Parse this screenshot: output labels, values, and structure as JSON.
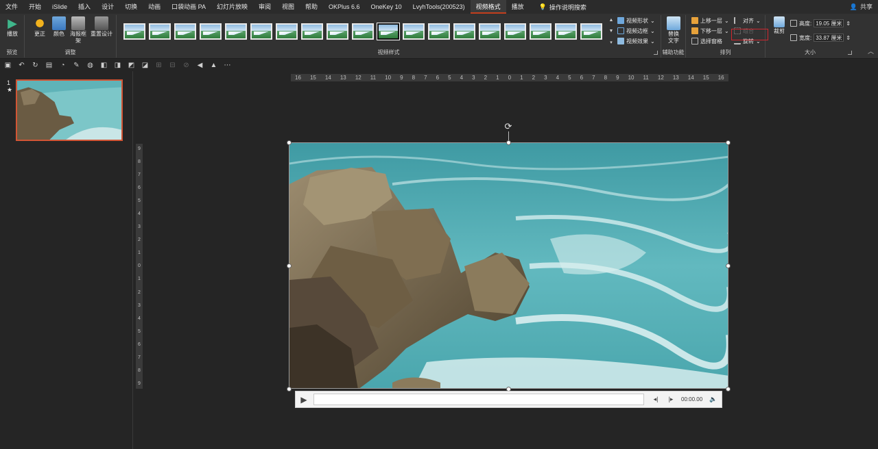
{
  "menu": {
    "tabs": [
      "文件",
      "开始",
      "iSlide",
      "插入",
      "设计",
      "切换",
      "动画",
      "口袋动画 PA",
      "幻灯片放映",
      "审阅",
      "视图",
      "帮助",
      "OKPlus 6.6",
      "OneKey 10",
      "LvyhTools(200523)",
      "视频格式",
      "播放"
    ],
    "active_tab": "视频格式",
    "search_label": "操作说明搜索",
    "share_label": "共享"
  },
  "ribbon": {
    "preview": {
      "play_label": "播放",
      "group_label": "预览"
    },
    "adjust": {
      "correct_label": "更正",
      "color_label": "颜色",
      "poster_label": "海报框架",
      "reset_label": "重置设计",
      "group_label": "调整"
    },
    "video_styles": {
      "group_label": "视频样式",
      "shape_label": "视频形状",
      "border_label": "视频边框",
      "effects_label": "视频效果",
      "thumb_count": 19,
      "selected_index": 10
    },
    "accessibility": {
      "alt_text_label": "替换文字",
      "group_label": "辅助功能"
    },
    "arrange": {
      "bring_forward": "上移一层",
      "send_backward": "下移一层",
      "selection_pane": "选择窗格",
      "align": "对齐",
      "group": "组合",
      "rotate": "旋转",
      "group_label": "排列"
    },
    "size": {
      "crop_label": "裁剪",
      "height_label": "高度:",
      "height_value": "19.05 厘米",
      "width_label": "宽度:",
      "width_value": "33.87 厘米",
      "group_label": "大小"
    }
  },
  "slides": {
    "number": "1",
    "star": "★"
  },
  "ruler": {
    "horizontal": [
      "16",
      "15",
      "14",
      "13",
      "12",
      "11",
      "10",
      "9",
      "8",
      "7",
      "6",
      "5",
      "4",
      "3",
      "2",
      "1",
      "0",
      "1",
      "2",
      "3",
      "4",
      "5",
      "6",
      "7",
      "8",
      "9",
      "10",
      "11",
      "12",
      "13",
      "14",
      "15",
      "16"
    ],
    "vertical": [
      "9",
      "8",
      "7",
      "6",
      "5",
      "4",
      "3",
      "2",
      "1",
      "0",
      "1",
      "2",
      "3",
      "4",
      "5",
      "6",
      "7",
      "8",
      "9"
    ]
  },
  "player": {
    "time": "00:00.00"
  },
  "colors": {
    "accent": "#c43e1c",
    "align_highlight": "#d0272f",
    "thumb_border": "#d25535"
  }
}
